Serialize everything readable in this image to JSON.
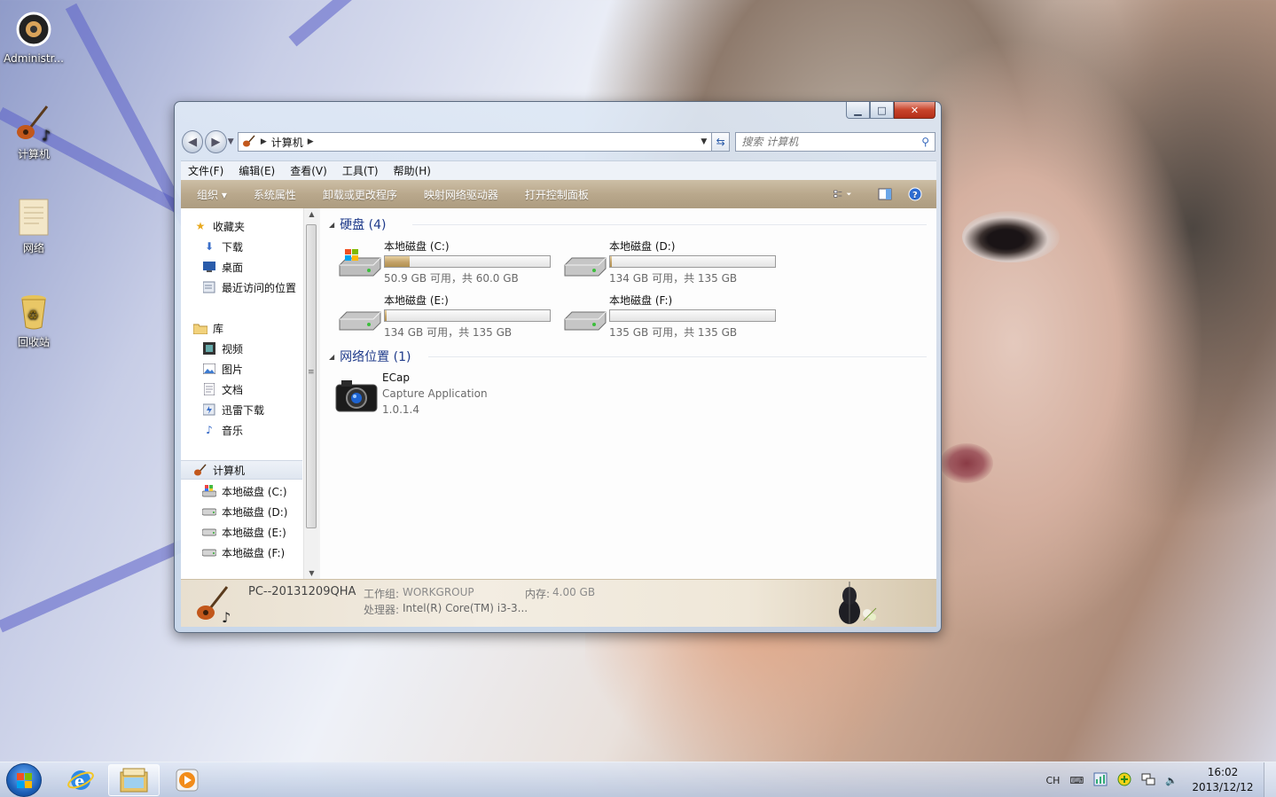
{
  "desktop": {
    "icons": [
      {
        "label": "Administr...",
        "icon": "user-speaker-icon"
      },
      {
        "label": "计算机",
        "icon": "guitar-computer-icon"
      },
      {
        "label": "网络",
        "icon": "paper-network-icon"
      },
      {
        "label": "回收站",
        "icon": "recycle-bin-icon"
      }
    ]
  },
  "window": {
    "caption": {
      "minimize": "▁",
      "maximize": "□",
      "close": "✕"
    },
    "address": {
      "root_icon": "guitar-icon",
      "crumb": "计算机"
    },
    "search": {
      "placeholder": "搜索 计算机"
    },
    "menu": [
      "文件(F)",
      "编辑(E)",
      "查看(V)",
      "工具(T)",
      "帮助(H)"
    ],
    "commands": [
      "组织 ▾",
      "系统属性",
      "卸载或更改程序",
      "映射网络驱动器",
      "打开控制面板"
    ],
    "nav": {
      "favorites": {
        "header": "收藏夹",
        "items": [
          "下载",
          "桌面",
          "最近访问的位置"
        ]
      },
      "libraries": {
        "header": "库",
        "items": [
          "视频",
          "图片",
          "文档",
          "迅雷下载",
          "音乐"
        ]
      },
      "computer": {
        "header": "计算机",
        "items": [
          "本地磁盘 (C:)",
          "本地磁盘 (D:)",
          "本地磁盘 (E:)",
          "本地磁盘 (F:)"
        ]
      }
    },
    "groups": {
      "drives_header": "硬盘 (4)",
      "network_header": "网络位置 (1)"
    },
    "drives": [
      {
        "name": "本地磁盘 (C:)",
        "free": "50.9 GB 可用，共 60.0 GB",
        "used_fraction": 0.15,
        "system": true
      },
      {
        "name": "本地磁盘 (D:)",
        "free": "134 GB 可用，共 135 GB",
        "used_fraction": 0.01,
        "system": false
      },
      {
        "name": "本地磁盘 (E:)",
        "free": "134 GB 可用，共 135 GB",
        "used_fraction": 0.01,
        "system": false
      },
      {
        "name": "本地磁盘 (F:)",
        "free": "135 GB 可用，共 135 GB",
        "used_fraction": 0.0,
        "system": false
      }
    ],
    "network_item": {
      "name": "ECap",
      "desc": "Capture Application",
      "version": "1.0.1.4"
    },
    "details": {
      "pc_name": "PC--20131209QHA",
      "workgroup_label": "工作组:",
      "workgroup": "WORKGROUP",
      "memory_label": "内存:",
      "memory": "4.00 GB",
      "cpu_label": "处理器:",
      "cpu": "Intel(R) Core(TM) i3-3..."
    }
  },
  "taskbar": {
    "tray_lang": "CH",
    "time": "16:02",
    "date": "2013/12/12"
  },
  "colors": {
    "accent": "#1e3a8a",
    "cmdbar": "#b9a88c",
    "fill": "#c3a269"
  }
}
